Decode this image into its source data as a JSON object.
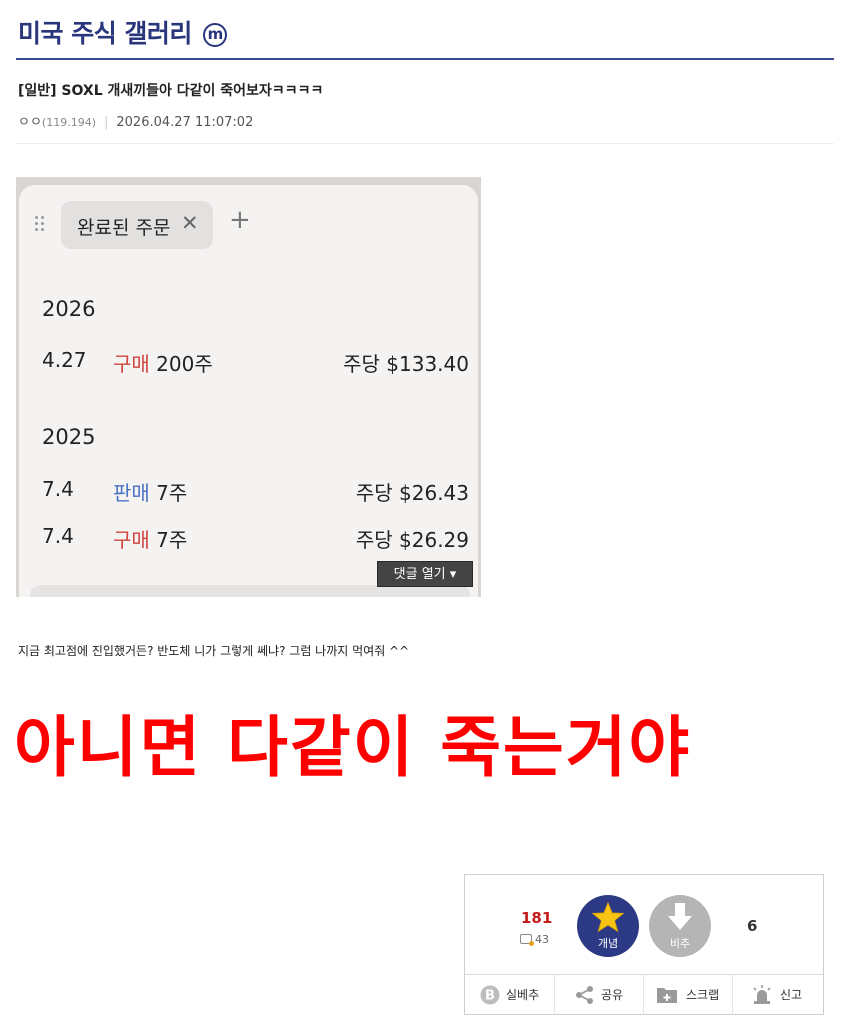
{
  "gallery": {
    "title": "미국 주식 갤러리",
    "badge": "ⓜ"
  },
  "post": {
    "title": "[일반] SOXL 개새끼들아 다같이 죽어보자ㅋㅋㅋㅋ",
    "author": "ㅇㅇ",
    "ip": "(119.194)",
    "datetime": "2026.04.27 11:07:02"
  },
  "screenshot": {
    "tab_label": "완료된 주문",
    "years": [
      "2026",
      "2025"
    ],
    "rows": [
      {
        "date": "4.27",
        "type": "구매",
        "qty": " 200주",
        "price": "주당 $133.40"
      },
      {
        "date": "7.4",
        "type": "판매",
        "qty": " 7주",
        "price": "주당 $26.43"
      },
      {
        "date": "7.4",
        "type": "구매",
        "qty": " 7주",
        "price": "주당 $26.29"
      }
    ],
    "comments_button": "댓글 열기 ▾"
  },
  "body": {
    "text": "지금 최고점에 진입했거든? 반도체 니가 그렇게 쎄냐? 그럼 나까지 먹여줘 ^^",
    "big_text": "아니면 다같이 죽는거야"
  },
  "vote": {
    "up_count": "181",
    "fixed_count": "43",
    "up_label": "개념",
    "down_label": "비추",
    "down_count": "6",
    "actions": [
      "실베추",
      "공유",
      "스크랩",
      "신고"
    ]
  },
  "colors": {
    "gallery_title": "#29367c",
    "buy": "#d0443f",
    "sell": "#4a72c4",
    "big_text": "#ff0000",
    "up_button": "#2c3a86",
    "down_button": "#b5b5b5",
    "up_count": "#c41b1b"
  }
}
